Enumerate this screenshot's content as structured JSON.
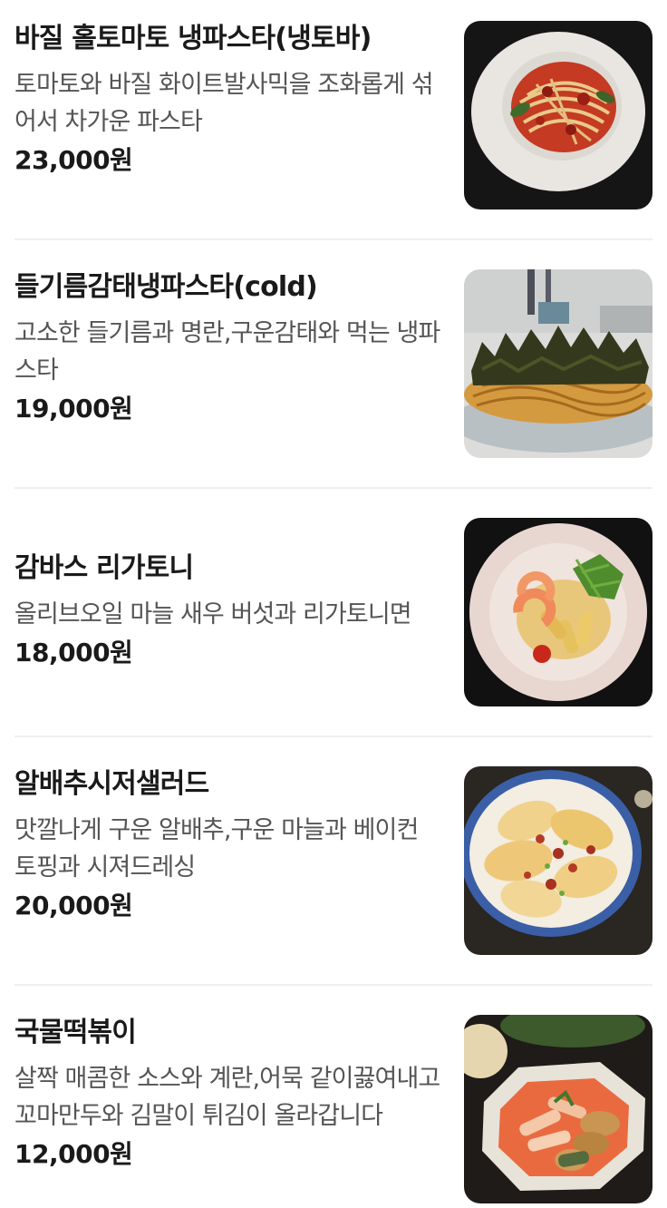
{
  "menu": {
    "items": [
      {
        "title": "바질 홀토마토 냉파스타(냉토바)",
        "description": "토마토와 바질 화이트발사믹을 조화롭게 섞어서 차가운 파스타",
        "price": "23,000원",
        "image_icon": "tomato-basil-pasta-photo"
      },
      {
        "title": "들기름감태냉파스타(cold)",
        "description": "고소한 들기름과 명란,구운감태와 먹는 냉파스타",
        "price": "19,000원",
        "image_icon": "perilla-seaweed-pasta-photo"
      },
      {
        "title": "감바스 리가토니",
        "description": "올리브오일 마늘 새우 버섯과 리가토니면",
        "price": "18,000원",
        "image_icon": "gambas-rigatoni-photo"
      },
      {
        "title": "알배추시저샐러드",
        "description": "맛깔나게 구운 알배추,구운 마늘과 베이컨 토핑과 시져드레싱",
        "price": "20,000원",
        "image_icon": "cabbage-caesar-salad-photo"
      },
      {
        "title": "국물떡볶이",
        "description": "살짝 매콤한 소스와 계란,어묵 같이끓여내고 꼬마만두와 김말이 튀김이 올라갑니다",
        "price": "12,000원",
        "image_icon": "soup-tteokbokki-photo"
      }
    ]
  },
  "colors": {
    "title": "#1a1a1a",
    "description": "#555555",
    "divider": "#efefef"
  }
}
